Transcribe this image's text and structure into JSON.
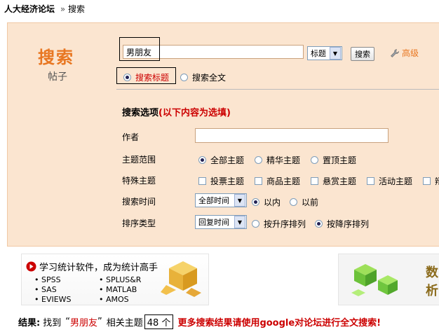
{
  "breadcrumb": {
    "forum": "人大经济论坛",
    "separator": "»",
    "current": "搜索"
  },
  "header": {
    "title": "搜索",
    "subtitle": "帖子"
  },
  "search": {
    "keyword": "男朋友",
    "type_select": "标题",
    "search_button": "搜索",
    "advanced_link": "高级",
    "scope": [
      {
        "label": "搜索标题",
        "checked": true
      },
      {
        "label": "搜索全文",
        "checked": false
      }
    ]
  },
  "options": {
    "title": "搜索选项",
    "title_note": "(以下内容为选填)",
    "author_label": "作者",
    "author_value": "",
    "range_label": "主题范围",
    "range": [
      {
        "label": "全部主题",
        "checked": true
      },
      {
        "label": "精华主题",
        "checked": false
      },
      {
        "label": "置顶主题",
        "checked": false
      }
    ],
    "special_label": "特殊主题",
    "special": [
      "投票主题",
      "商品主题",
      "悬赏主题",
      "活动主题",
      "辩"
    ],
    "time_label": "搜索时间",
    "time_select": "全部时间",
    "time_dir": [
      {
        "label": "以内",
        "checked": true
      },
      {
        "label": "以前",
        "checked": false
      }
    ],
    "sort_label": "排序类型",
    "sort_select": "回复时间",
    "sort_dir": [
      {
        "label": "按升序排列",
        "checked": false
      },
      {
        "label": "按降序排列",
        "checked": true
      }
    ]
  },
  "ad_left": {
    "headline": "学习统计软件，成为统计高手",
    "items": [
      "SPSS",
      "SPLUS&R",
      "SAS",
      "MATLAB",
      "EVIEWS",
      "AMOS"
    ]
  },
  "ad_right": {
    "text_1": "数",
    "text_2": "析"
  },
  "result": {
    "label": "结果:",
    "found": "找到",
    "quote_open": "“",
    "keyword": "男朋友",
    "quote_close": "”",
    "related": "相关主题",
    "count": "48 个",
    "more": "更多搜索结果请使用google对论坛进行全文搜索!"
  },
  "colors": {
    "accent": "#e87722",
    "panel_bg": "#fbe5d0",
    "highlight_red": "#cc0000"
  }
}
